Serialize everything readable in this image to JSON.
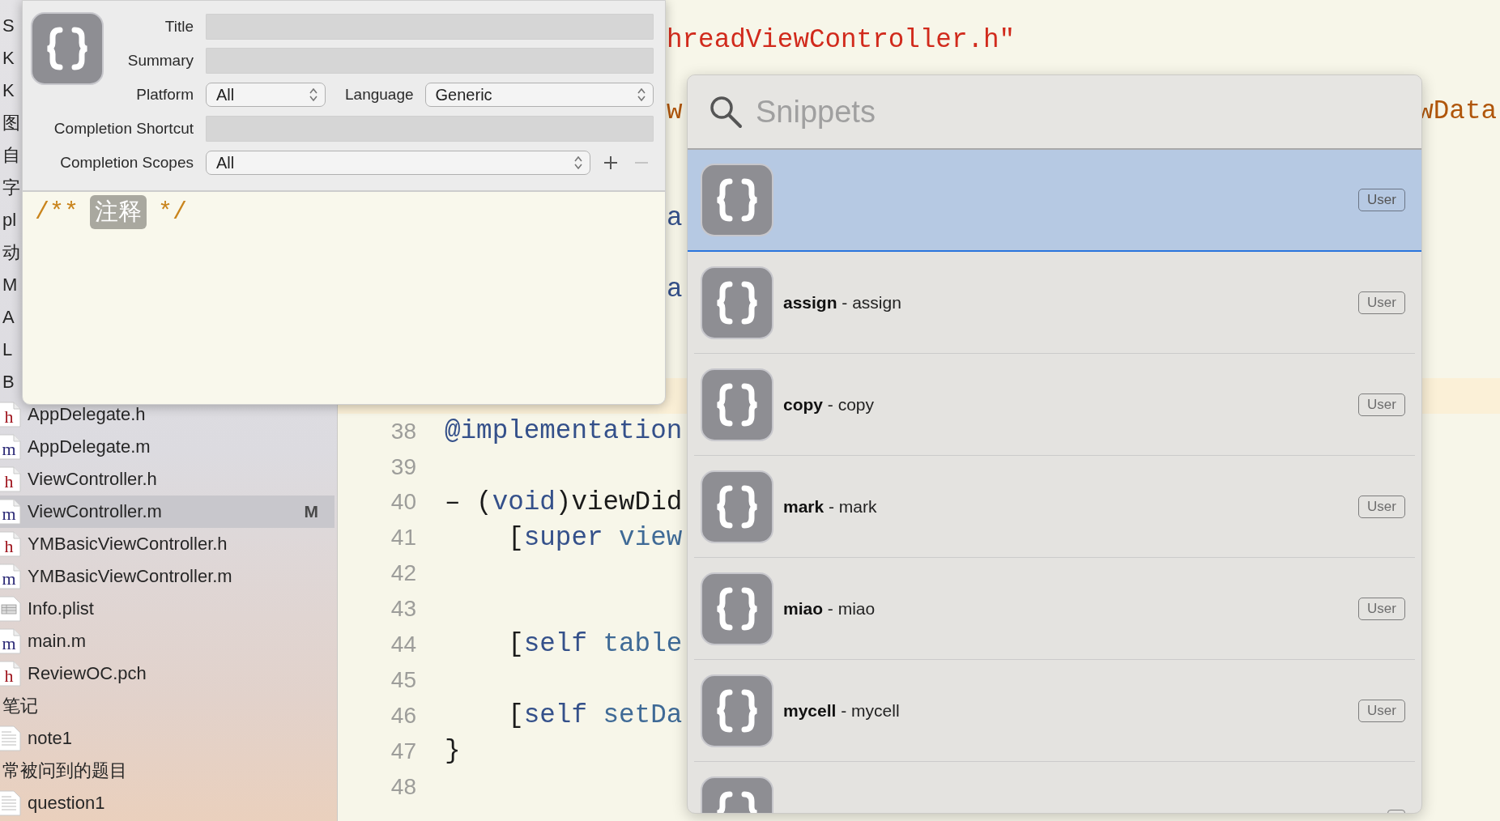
{
  "navigator": {
    "items": [
      {
        "label": "S",
        "kind": "group",
        "selected": false
      },
      {
        "label": "K",
        "kind": "group",
        "selected": false
      },
      {
        "label": "K",
        "kind": "group",
        "selected": false
      },
      {
        "label": "图",
        "kind": "group",
        "selected": false
      },
      {
        "label": "自",
        "kind": "group",
        "selected": false
      },
      {
        "label": "字",
        "kind": "group",
        "selected": false
      },
      {
        "label": "pl",
        "kind": "group",
        "selected": false
      },
      {
        "label": "动",
        "kind": "group",
        "selected": false
      },
      {
        "label": "M",
        "kind": "group",
        "selected": false
      },
      {
        "label": "A",
        "kind": "group",
        "selected": false
      },
      {
        "label": "L",
        "kind": "group",
        "selected": false
      },
      {
        "label": "B",
        "kind": "group",
        "selected": false
      },
      {
        "label": "AppDelegate.h",
        "kind": "header",
        "icon_text": "h",
        "selected": false
      },
      {
        "label": "AppDelegate.m",
        "kind": "source",
        "icon_text": "m",
        "selected": false
      },
      {
        "label": "ViewController.h",
        "kind": "header",
        "icon_text": "h",
        "selected": false
      },
      {
        "label": "ViewController.m",
        "kind": "source",
        "icon_text": "m",
        "selected": true,
        "badge": "M"
      },
      {
        "label": "YMBasicViewController.h",
        "kind": "header",
        "icon_text": "h",
        "selected": false
      },
      {
        "label": "YMBasicViewController.m",
        "kind": "source",
        "icon_text": "m",
        "selected": false
      },
      {
        "label": "Info.plist",
        "kind": "plist",
        "selected": false
      },
      {
        "label": "main.m",
        "kind": "source",
        "icon_text": "m",
        "selected": false
      },
      {
        "label": "ReviewOC.pch",
        "kind": "header",
        "icon_text": "h",
        "selected": false
      },
      {
        "label": "笔记",
        "kind": "group",
        "selected": false
      },
      {
        "label": "note1",
        "kind": "document",
        "selected": false
      },
      {
        "label": "常被问到的题目",
        "kind": "group",
        "selected": false
      },
      {
        "label": "question1",
        "kind": "document",
        "selected": false
      }
    ]
  },
  "editor": {
    "lines": [
      {
        "current": false
      },
      {
        "kind": "covered",
        "current": false,
        "segments": [
          {
            "text": "hreadViewController.h\"",
            "kind": "string"
          }
        ]
      },
      {
        "current": false
      },
      {
        "kind": "covered",
        "current": false,
        "segments": [
          {
            "text": "w",
            "kind": "type"
          },
          {
            "text": "wData",
            "kind": "type"
          }
        ]
      },
      {
        "current": false
      },
      {
        "current": false
      },
      {
        "kind": "covered",
        "current": false,
        "segments": [
          {
            "text": "a",
            "kind": "keyword"
          }
        ]
      },
      {
        "current": false
      },
      {
        "kind": "covered",
        "current": false,
        "segments": [
          {
            "text": "a",
            "kind": "keyword"
          }
        ]
      },
      {
        "current": false
      },
      {
        "current": false
      },
      {
        "current": true
      },
      {
        "kind": "code",
        "current": false,
        "number": "38",
        "segments": [
          {
            "text": "@implementation",
            "kind": "keyword"
          }
        ]
      },
      {
        "current": false,
        "number": "39"
      },
      {
        "kind": "code",
        "current": false,
        "number": "40",
        "segments": [
          {
            "text": "– (",
            "kind": "plain"
          },
          {
            "text": "void",
            "kind": "keyword"
          },
          {
            "text": ")viewDid",
            "kind": "plain"
          }
        ]
      },
      {
        "kind": "code",
        "current": false,
        "number": "41",
        "segments": [
          {
            "text": "    [",
            "kind": "plain"
          },
          {
            "text": "super",
            "kind": "keyword"
          },
          {
            "text": " view",
            "kind": "identifier"
          }
        ]
      },
      {
        "current": false,
        "number": "42"
      },
      {
        "current": false,
        "number": "43"
      },
      {
        "kind": "code",
        "current": false,
        "number": "44",
        "segments": [
          {
            "text": "    [",
            "kind": "plain"
          },
          {
            "text": "self",
            "kind": "keyword"
          },
          {
            "text": " table",
            "kind": "identifier"
          }
        ]
      },
      {
        "current": false,
        "number": "45"
      },
      {
        "kind": "code",
        "current": false,
        "number": "46",
        "segments": [
          {
            "text": "    [",
            "kind": "plain"
          },
          {
            "text": "self",
            "kind": "keyword"
          },
          {
            "text": " setDa",
            "kind": "identifier"
          }
        ]
      },
      {
        "kind": "code",
        "current": false,
        "number": "47",
        "segments": [
          {
            "text": "}",
            "kind": "plain"
          }
        ]
      },
      {
        "current": false,
        "number": "48"
      }
    ]
  },
  "snippet_editor": {
    "title": {
      "label": "Title"
    },
    "summary": {
      "label": "Summary"
    },
    "platform": {
      "label": "Platform",
      "value": "All"
    },
    "language": {
      "label": "Language",
      "value": "Generic"
    },
    "completion_shortcut": {
      "label": "Completion Shortcut"
    },
    "completion_scopes": {
      "label": "Completion Scopes",
      "value": "All",
      "remove_disabled": true
    },
    "body": {
      "segments": [
        {
          "text": "/**",
          "kind": "comment"
        },
        {
          "text": "注释",
          "kind": "token"
        },
        {
          "text": "*/",
          "kind": "comment"
        }
      ]
    }
  },
  "snippet_library": {
    "search": {
      "placeholder": "Snippets"
    },
    "snippets": [
      {
        "selected": true,
        "scope": "User"
      },
      {
        "selected": false,
        "title": "**assign** - assign",
        "scope": "User"
      },
      {
        "selected": false,
        "title": "**copy** - copy",
        "scope": "User"
      },
      {
        "selected": false,
        "title": "**mark** - mark",
        "scope": "User"
      },
      {
        "selected": false,
        "title": "**miao** - miao",
        "scope": "User"
      },
      {
        "selected": false,
        "title": "**mycell** - mycell",
        "scope": "User"
      },
      {
        "selected": false
      }
    ]
  }
}
